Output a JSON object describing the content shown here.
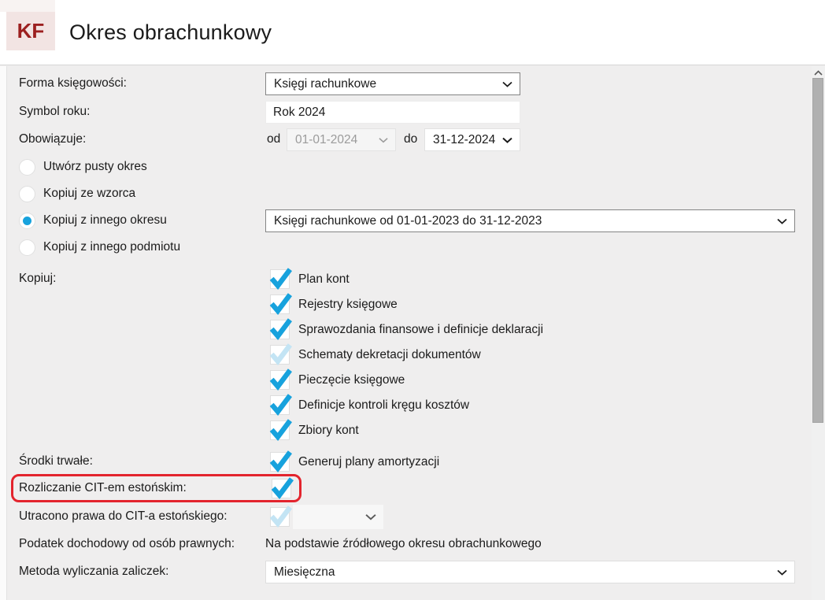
{
  "header": {
    "app_badge": "KF",
    "title": "Okres obrachunkowy"
  },
  "colors": {
    "accent_blue": "#17a2dd",
    "faded_blue": "#c3e4f4",
    "brand_red": "#9c2020",
    "badge_background": "#f2e4e3",
    "annotation_red": "#e3242d",
    "page_background": "#efeeee"
  },
  "form": {
    "forma_ksiegowosci": {
      "label": "Forma księgowości:",
      "value": "Księgi rachunkowe"
    },
    "symbol_roku": {
      "label": "Symbol roku:",
      "value": "Rok 2024"
    },
    "obowiazuje": {
      "label": "Obowiązuje:",
      "od_label": "od",
      "od_value": "01-01-2024",
      "od_disabled": true,
      "do_label": "do",
      "do_value": "31-12-2024"
    },
    "radio_options": [
      {
        "label": "Utwórz pusty okres",
        "selected": false
      },
      {
        "label": "Kopiuj ze wzorca",
        "selected": false
      },
      {
        "label": "Kopiuj z innego okresu",
        "selected": true
      },
      {
        "label": "Kopiuj z innego podmiotu",
        "selected": false
      }
    ],
    "kopiuj_z_okresu_value": "Księgi rachunkowe od 01-01-2023 do 31-12-2023",
    "kopiuj": {
      "label": "Kopiuj:",
      "items": [
        {
          "label": "Plan kont",
          "checked": true
        },
        {
          "label": "Rejestry księgowe",
          "checked": true
        },
        {
          "label": "Sprawozdania finansowe i definicje deklaracji",
          "checked": true
        },
        {
          "label": "Schematy dekretacji dokumentów",
          "checked": false
        },
        {
          "label": "Pieczęcie księgowe",
          "checked": true
        },
        {
          "label": "Definicje kontroli kręgu kosztów",
          "checked": true
        },
        {
          "label": "Zbiory kont",
          "checked": true
        }
      ]
    },
    "srodki_trwale": {
      "label": "Środki trwałe:",
      "item_label": "Generuj plany amortyzacji",
      "checked": true
    },
    "cit_estonski": {
      "label": "Rozliczanie CIT-em estońskim:",
      "checked": true,
      "highlighted": true
    },
    "utracono_prawa": {
      "label": "Utracono prawa do CIT-a estońskiego:",
      "checked": false,
      "value": ""
    },
    "podatek_dochodowy": {
      "label": "Podatek dochodowy od osób prawnych:",
      "value": "Na podstawie źródłowego okresu obrachunkowego"
    },
    "metoda_zaliczek": {
      "label": "Metoda wyliczania zaliczek:",
      "value": "Miesięczna"
    }
  }
}
